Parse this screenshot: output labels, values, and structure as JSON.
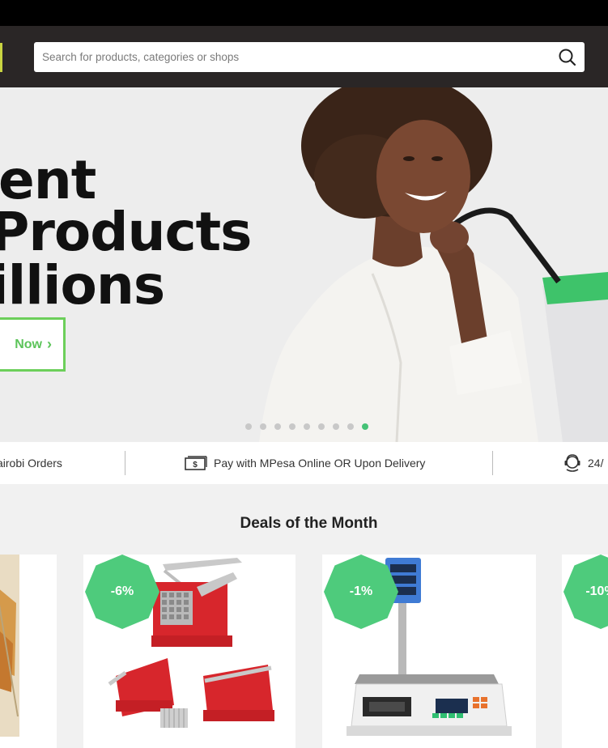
{
  "search": {
    "placeholder": "Search for products, categories or shops"
  },
  "hero": {
    "lines": [
      "ent",
      "Products",
      "illions"
    ],
    "cta_label": "Now",
    "cta_arrow": "›",
    "slide_count": 9,
    "active_slide": 9
  },
  "features": [
    {
      "text": "airobi Orders",
      "icon": "delivery-icon"
    },
    {
      "text": "Pay with MPesa Online OR Upon Delivery",
      "icon": "cash-icon"
    },
    {
      "text": "24/",
      "icon": "support-agent-icon"
    }
  ],
  "deals": {
    "title": "Deals of the Month",
    "products": [
      {
        "badge": "",
        "image": "product-image-partial"
      },
      {
        "badge": "-6%",
        "image": "potato-cutter-image"
      },
      {
        "badge": "-1%",
        "image": "digital-scale-image"
      },
      {
        "badge": "-10%",
        "image": "product-image-partial"
      }
    ]
  },
  "colors": {
    "topbar": "#000000",
    "header": "#2a2626",
    "accent_green": "#45c276",
    "badge_green": "#4ecb7c",
    "cta_green": "#5cc45a",
    "hero_bg": "#ededed"
  }
}
